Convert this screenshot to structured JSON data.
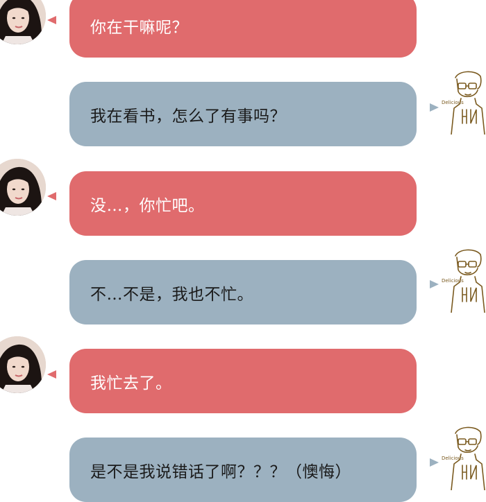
{
  "colors": {
    "her_bubble": "#E06B6D",
    "him_bubble": "#9CB1C0",
    "him_text": "#1a1a1a",
    "her_text": "#ffffff"
  },
  "messages": [
    {
      "sender": "her",
      "text": "你在干嘛呢？"
    },
    {
      "sender": "him",
      "text": "我在看书，怎么了有事吗？",
      "avatar_caption": "Delicious"
    },
    {
      "sender": "her",
      "text": "没…，你忙吧。"
    },
    {
      "sender": "him",
      "text": "不…不是，我也不忙。",
      "avatar_caption": "Delicious"
    },
    {
      "sender": "her",
      "text": "我忙去了。"
    },
    {
      "sender": "him",
      "text": "是不是我说错话了啊？？？（懊悔）",
      "avatar_caption": "Delicious"
    }
  ]
}
